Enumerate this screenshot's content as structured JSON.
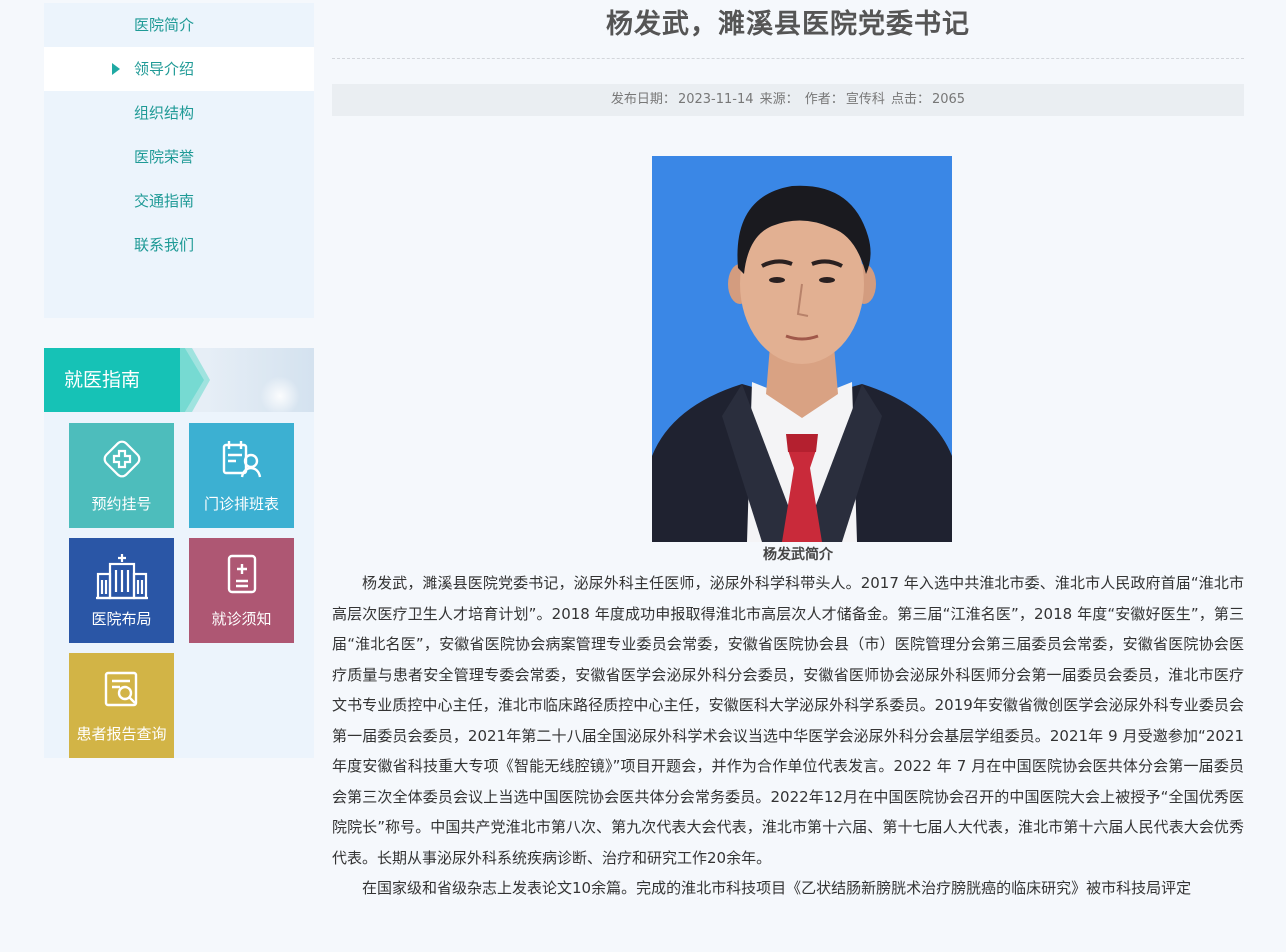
{
  "sidebar": {
    "items": [
      {
        "label": "医院简介",
        "active": false
      },
      {
        "label": "领导介绍",
        "active": true
      },
      {
        "label": "组织结构",
        "active": false
      },
      {
        "label": "医院荣誉",
        "active": false
      },
      {
        "label": "交通指南",
        "active": false
      },
      {
        "label": "联系我们",
        "active": false
      }
    ]
  },
  "guide": {
    "title": "就医指南",
    "tiles": [
      {
        "label": "预约挂号",
        "icon": "medical-cross-icon",
        "color": "#4dbdbc"
      },
      {
        "label": "门诊排班表",
        "icon": "schedule-icon",
        "color": "#3cb0d2"
      },
      {
        "label": "医院布局",
        "icon": "hospital-building-icon",
        "color": "#2a56a6"
      },
      {
        "label": "就诊须知",
        "icon": "notice-icon",
        "color": "#ae5773"
      },
      {
        "label": "患者报告查询",
        "icon": "report-search-icon",
        "color": "#d2b446"
      }
    ]
  },
  "article": {
    "title": "杨发武，濉溪县医院党委书记",
    "meta": {
      "date_label": "发布日期：",
      "date": "2023-11-14",
      "source_label": "来源：",
      "author_label": "作者：",
      "author": "宣传科",
      "clicks_label": "点击：",
      "clicks": "2065"
    },
    "photo_caption": "杨发武简介",
    "paragraphs": [
      "杨发武，濉溪县医院党委书记，泌尿外科主任医师，泌尿外科学科带头人。2017 年入选中共淮北市委、淮北市人民政府首届“淮北市高层次医疗卫生人才培育计划”。2018 年度成功申报取得淮北市高层次人才储备金。第三届“江淮名医”，2018 年度“安徽好医生”，第三届“淮北名医”，安徽省医院协会病案管理专业委员会常委，安徽省医院协会县（市）医院管理分会第三届委员会常委，安徽省医院协会医疗质量与患者安全管理专委会常委，安徽省医学会泌尿外科分会委员，安徽省医师协会泌尿外科医师分会第一届委员会委员，淮北市医疗文书专业质控中心主任，淮北市临床路径质控中心主任，安徽医科大学泌尿外科学系委员。2019年安徽省微创医学会泌尿外科专业委员会第一届委员会委员，2021年第二十八届全国泌尿外科学术会议当选中华医学会泌尿外科分会基层学组委员。2021年 9 月受邀参加“2021年度安徽省科技重大专项《智能无线腔镜》”项目开题会，并作为合作单位代表发言。2022 年 7 月在中国医院协会医共体分会第一届委员会第三次全体委员会议上当选中国医院协会医共体分会常务委员。2022年12月在中国医院协会召开的中国医院大会上被授予“全国优秀医院院长”称号。中国共产党淮北市第八次、第九次代表大会代表，淮北市第十六届、第十七届人大代表，淮北市第十六届人民代表大会优秀代表。长期从事泌尿外科系统疾病诊断、治疗和研究工作20余年。",
      "在国家级和省级杂志上发表论文10余篇。完成的淮北市科技项目《乙状结肠新膀胱术治疗膀胱癌的临床研究》被市科技局评定"
    ]
  }
}
